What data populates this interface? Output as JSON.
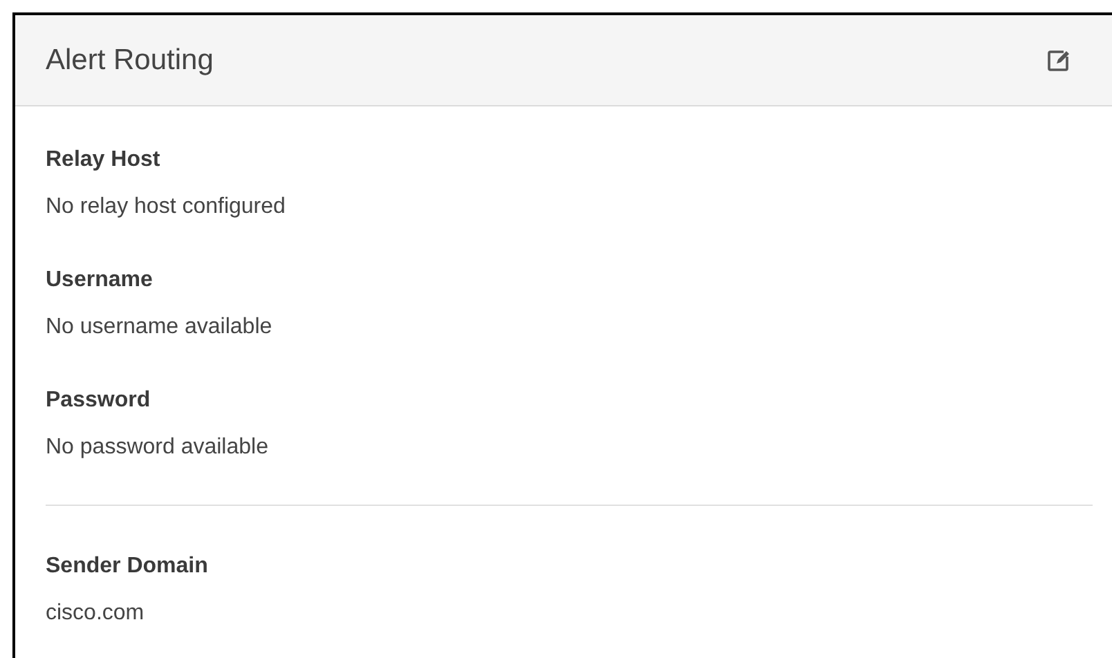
{
  "panel": {
    "title": "Alert Routing"
  },
  "sections": [
    {
      "fields": [
        {
          "label": "Relay Host",
          "value": "No relay host configured"
        },
        {
          "label": "Username",
          "value": "No username available"
        },
        {
          "label": "Password",
          "value": "No password available"
        }
      ]
    },
    {
      "fields": [
        {
          "label": "Sender Domain",
          "value": "cisco.com"
        }
      ]
    }
  ]
}
